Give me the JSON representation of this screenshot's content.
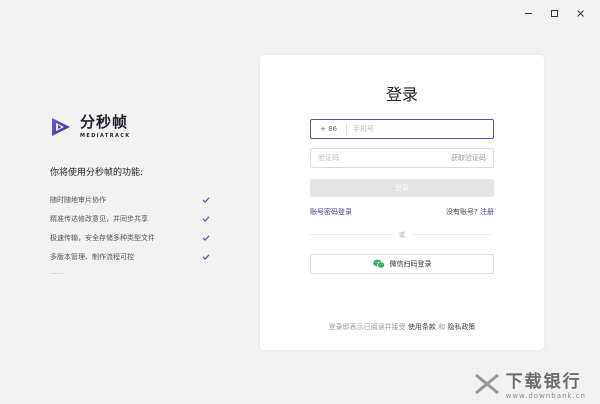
{
  "window": {
    "controls": [
      "minimize-icon",
      "maximize-icon",
      "close-icon"
    ]
  },
  "brand": {
    "name": "分秒帧",
    "sub": "MEDIATRACK",
    "accent": "#4a3c9c"
  },
  "features": {
    "title": "你将使用分秒帧的功能:",
    "items": [
      {
        "label": "随时随地审片协作"
      },
      {
        "label": "精准传达修改意见，并同步共享"
      },
      {
        "label": "极速传输，安全存储多种类型文件"
      },
      {
        "label": "多版本管理、制作流程可控"
      }
    ],
    "more": "......"
  },
  "login": {
    "title": "登录",
    "country_code": "+ 86",
    "phone_placeholder": "手机号",
    "code_placeholder": "验证码",
    "get_code": "获取验证码",
    "submit": "登录",
    "password_login": "账号密码登录",
    "no_account": "没有账号?",
    "register": "注册",
    "or": "或",
    "wechat_login": "微信扫码登录",
    "terms_prefix": "登录即表示已阅读并接受",
    "terms_of_use": "使用条款",
    "and": "和",
    "privacy": "隐私政策"
  },
  "watermark": {
    "text": "下载银行",
    "url": "www.downbank.cn"
  }
}
